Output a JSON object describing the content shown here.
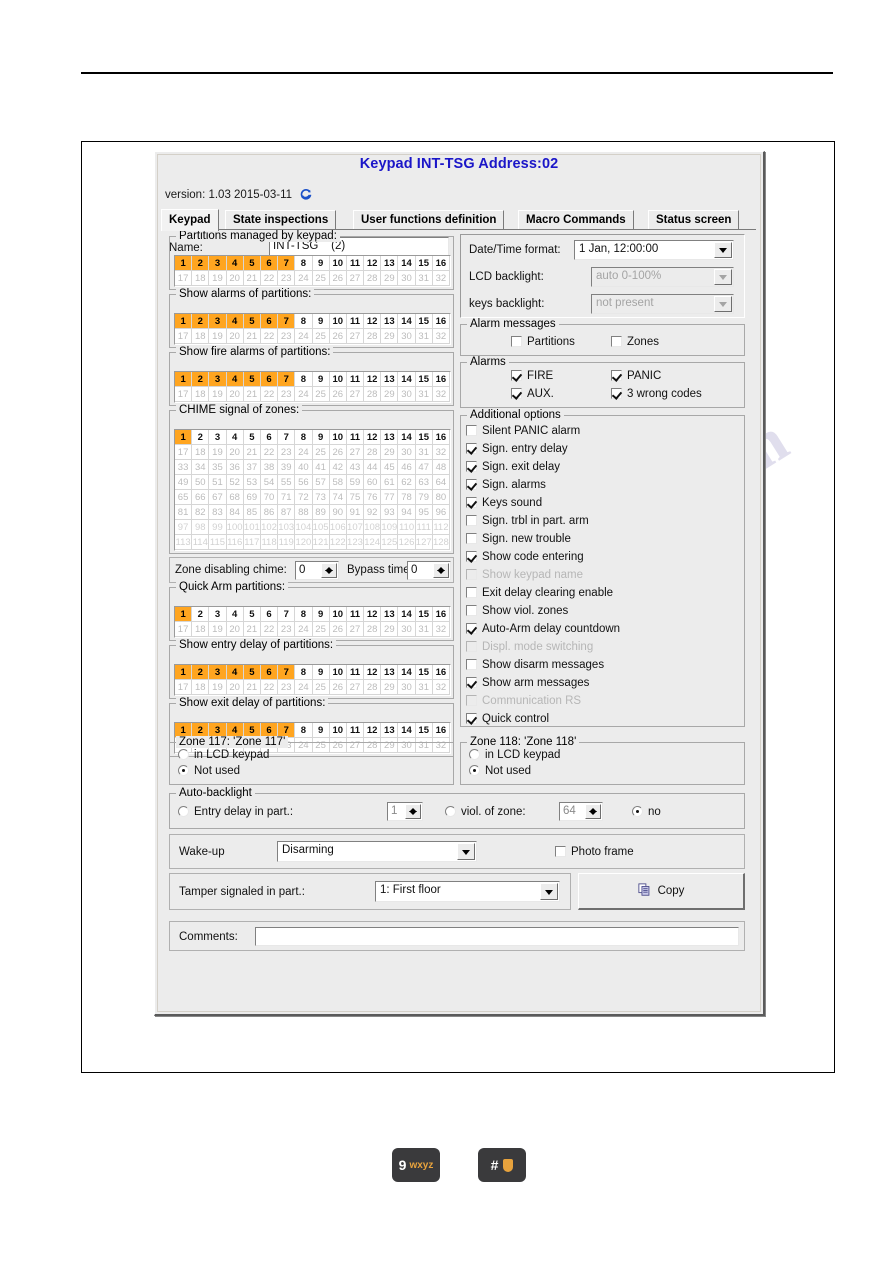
{
  "dialog": {
    "title": "Keypad INT-TSG Address:02",
    "version": "version: 1.03 2015-03-11",
    "refresh_icon": "refresh-icon",
    "tabs": [
      {
        "label": "Keypad",
        "active": true
      },
      {
        "label": "State inspections",
        "active": false
      },
      {
        "label": "User functions definition",
        "active": false
      },
      {
        "label": "Macro Commands",
        "active": false
      },
      {
        "label": "Status screen",
        "active": false
      }
    ]
  },
  "name_field": {
    "label": "Name:",
    "value": "INT-TSG    (2)"
  },
  "display": {
    "datetime_label": "Date/Time format:",
    "datetime_value": "1 Jan, 12:00:00",
    "lcd_backlight_label": "LCD backlight:",
    "lcd_backlight_value": "auto 0-100%",
    "keys_backlight_label": "keys backlight:",
    "keys_backlight_value": "not present"
  },
  "alarm_messages": {
    "title": "Alarm messages",
    "items": [
      {
        "label": "Partitions",
        "checked": false
      },
      {
        "label": "Zones",
        "checked": false
      }
    ]
  },
  "alarms": {
    "title": "Alarms",
    "items": [
      {
        "label": "FIRE",
        "checked": true
      },
      {
        "label": "PANIC",
        "checked": true
      },
      {
        "label": "AUX.",
        "checked": true
      },
      {
        "label": "3 wrong codes",
        "checked": true
      }
    ]
  },
  "additional_options": {
    "title": "Additional options",
    "items": [
      {
        "label": "Silent PANIC alarm",
        "checked": false,
        "disabled": false
      },
      {
        "label": "Sign. entry delay",
        "checked": true,
        "disabled": false
      },
      {
        "label": "Sign. exit delay",
        "checked": true,
        "disabled": false
      },
      {
        "label": "Sign. alarms",
        "checked": true,
        "disabled": false
      },
      {
        "label": "Keys sound",
        "checked": true,
        "disabled": false
      },
      {
        "label": "Sign. trbl in part. arm",
        "checked": false,
        "disabled": false
      },
      {
        "label": "Sign. new trouble",
        "checked": false,
        "disabled": false
      },
      {
        "label": "Show code entering",
        "checked": true,
        "disabled": false
      },
      {
        "label": "Show keypad name",
        "checked": false,
        "disabled": true
      },
      {
        "label": "Exit delay clearing enable",
        "checked": false,
        "disabled": false
      },
      {
        "label": "Show viol. zones",
        "checked": false,
        "disabled": false
      },
      {
        "label": "Auto-Arm delay countdown",
        "checked": true,
        "disabled": false
      },
      {
        "label": "Displ. mode switching",
        "checked": false,
        "disabled": true
      },
      {
        "label": "Show disarm messages",
        "checked": false,
        "disabled": false
      },
      {
        "label": "Show arm messages",
        "checked": true,
        "disabled": false
      },
      {
        "label": "Communication RS",
        "checked": false,
        "disabled": true
      },
      {
        "label": "Quick control",
        "checked": true,
        "disabled": false
      }
    ]
  },
  "partition_grids": [
    {
      "title": "Partitions managed by keypad:",
      "rows": 2,
      "cols": 16,
      "total": 32,
      "enabled_max": 16,
      "selected": [
        1,
        2,
        3,
        4,
        5,
        6,
        7
      ]
    },
    {
      "title": "Show alarms of partitions:",
      "rows": 2,
      "cols": 16,
      "total": 32,
      "enabled_max": 16,
      "selected": [
        1,
        2,
        3,
        4,
        5,
        6,
        7
      ]
    },
    {
      "title": "Show fire alarms of partitions:",
      "rows": 2,
      "cols": 16,
      "total": 32,
      "enabled_max": 16,
      "selected": [
        1,
        2,
        3,
        4,
        5,
        6,
        7
      ]
    }
  ],
  "chime_grid": {
    "title": "CHIME signal of zones:",
    "rows": 8,
    "cols": 16,
    "total": 128,
    "enabled_max": 16,
    "selected": [
      1
    ]
  },
  "chime_spinners": {
    "zone_disabling_label": "Zone disabling chime:",
    "zone_disabling_value": "0",
    "bypass_label": "Bypass time:",
    "bypass_value": "0"
  },
  "partition_grids2": [
    {
      "title": "Quick Arm partitions:",
      "rows": 2,
      "cols": 16,
      "total": 32,
      "enabled_max": 16,
      "selected": [
        1
      ]
    },
    {
      "title": "Show entry delay of partitions:",
      "rows": 2,
      "cols": 16,
      "total": 32,
      "enabled_max": 16,
      "selected": [
        1,
        2,
        3,
        4,
        5,
        6,
        7
      ]
    },
    {
      "title": "Show exit delay of partitions:",
      "rows": 2,
      "cols": 16,
      "total": 32,
      "enabled_max": 16,
      "selected": [
        1,
        2,
        3,
        4,
        5,
        6,
        7
      ]
    }
  ],
  "zone117": {
    "title": "Zone 117: 'Zone 117'",
    "options": [
      {
        "label": "in LCD keypad",
        "selected": false
      },
      {
        "label": "Not used",
        "selected": true
      }
    ]
  },
  "zone118": {
    "title": "Zone 118: 'Zone 118'",
    "options": [
      {
        "label": "in LCD keypad",
        "selected": false
      },
      {
        "label": "Not used",
        "selected": true
      }
    ]
  },
  "auto_backlight": {
    "title": "Auto-backlight",
    "entry_delay_label": "Entry delay in part.:",
    "entry_delay_selected": false,
    "entry_delay_value": "1",
    "viol_zone_label": "viol. of zone:",
    "viol_zone_selected": false,
    "viol_zone_value": "64",
    "no_label": "no",
    "no_selected": true
  },
  "wakeup": {
    "label": "Wake-up",
    "value": "Disarming",
    "photo_frame_label": "Photo frame",
    "photo_frame_checked": false
  },
  "tamper": {
    "label": "Tamper signaled in part.:",
    "value": "1: First floor",
    "copy_label": "Copy",
    "copy_icon": "copy-icon"
  },
  "comments": {
    "label": "Comments:",
    "value": ""
  },
  "keypad_keys": [
    {
      "main": "9",
      "sub": "wxyz",
      "shield": false
    },
    {
      "main": "#",
      "sub": "",
      "shield": true
    }
  ],
  "colors": {
    "accent_orange": "#FFA520",
    "title_blue": "#1B16C8",
    "dialog_face": "#ECECEC"
  }
}
